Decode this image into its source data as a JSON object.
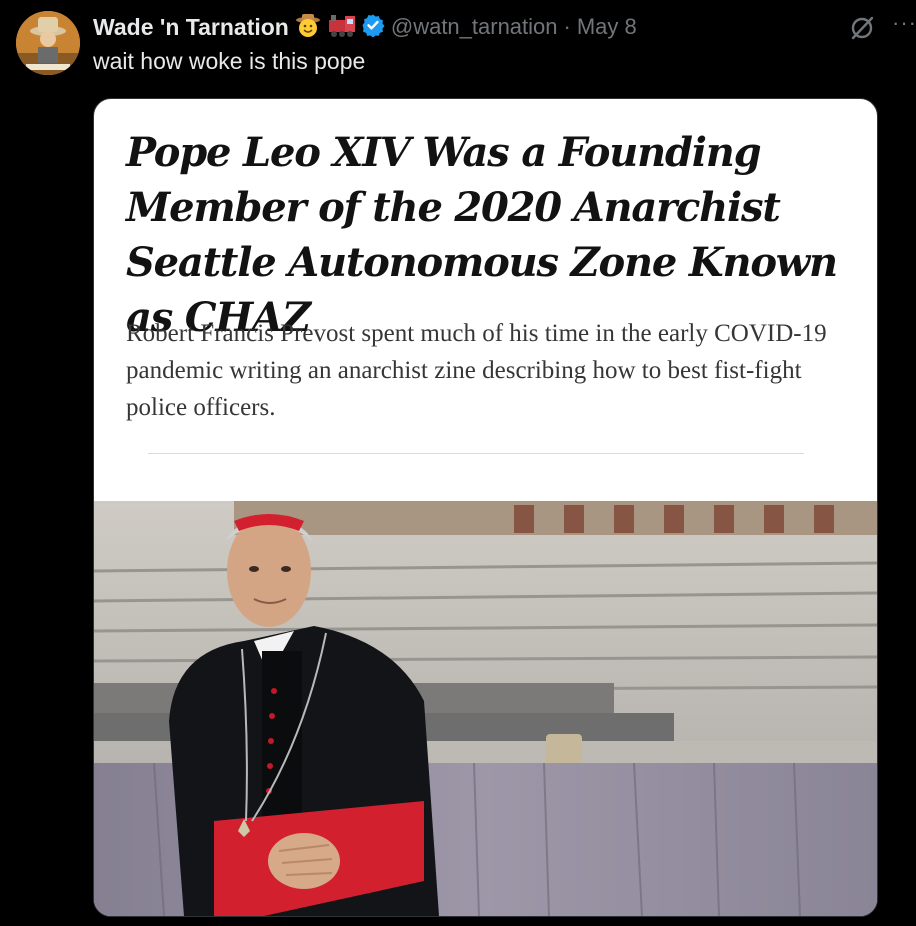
{
  "tweet": {
    "display_name": "Wade 'n Tarnation",
    "name_emojis": [
      "cowboy-face-icon",
      "locomotive-icon"
    ],
    "handle": "@watn_tarnation",
    "separator": "·",
    "date": "May 8",
    "text": "wait how woke is this pope",
    "more_label": "···"
  },
  "article": {
    "headline": "Pope Leo XIV Was a Founding Member of the 2020 Anarchist Seattle Autonomous Zone Known as CHAZ",
    "subheadline": "Robert Francis Prevost spent much of his time in the early COVID-19 pandemic writing an anarchist zine describing how to best fist-fight police officers."
  },
  "colors": {
    "background": "#000000",
    "text_primary": "#e7e9ea",
    "text_secondary": "#71767b",
    "verified_blue": "#1d9bf0"
  }
}
